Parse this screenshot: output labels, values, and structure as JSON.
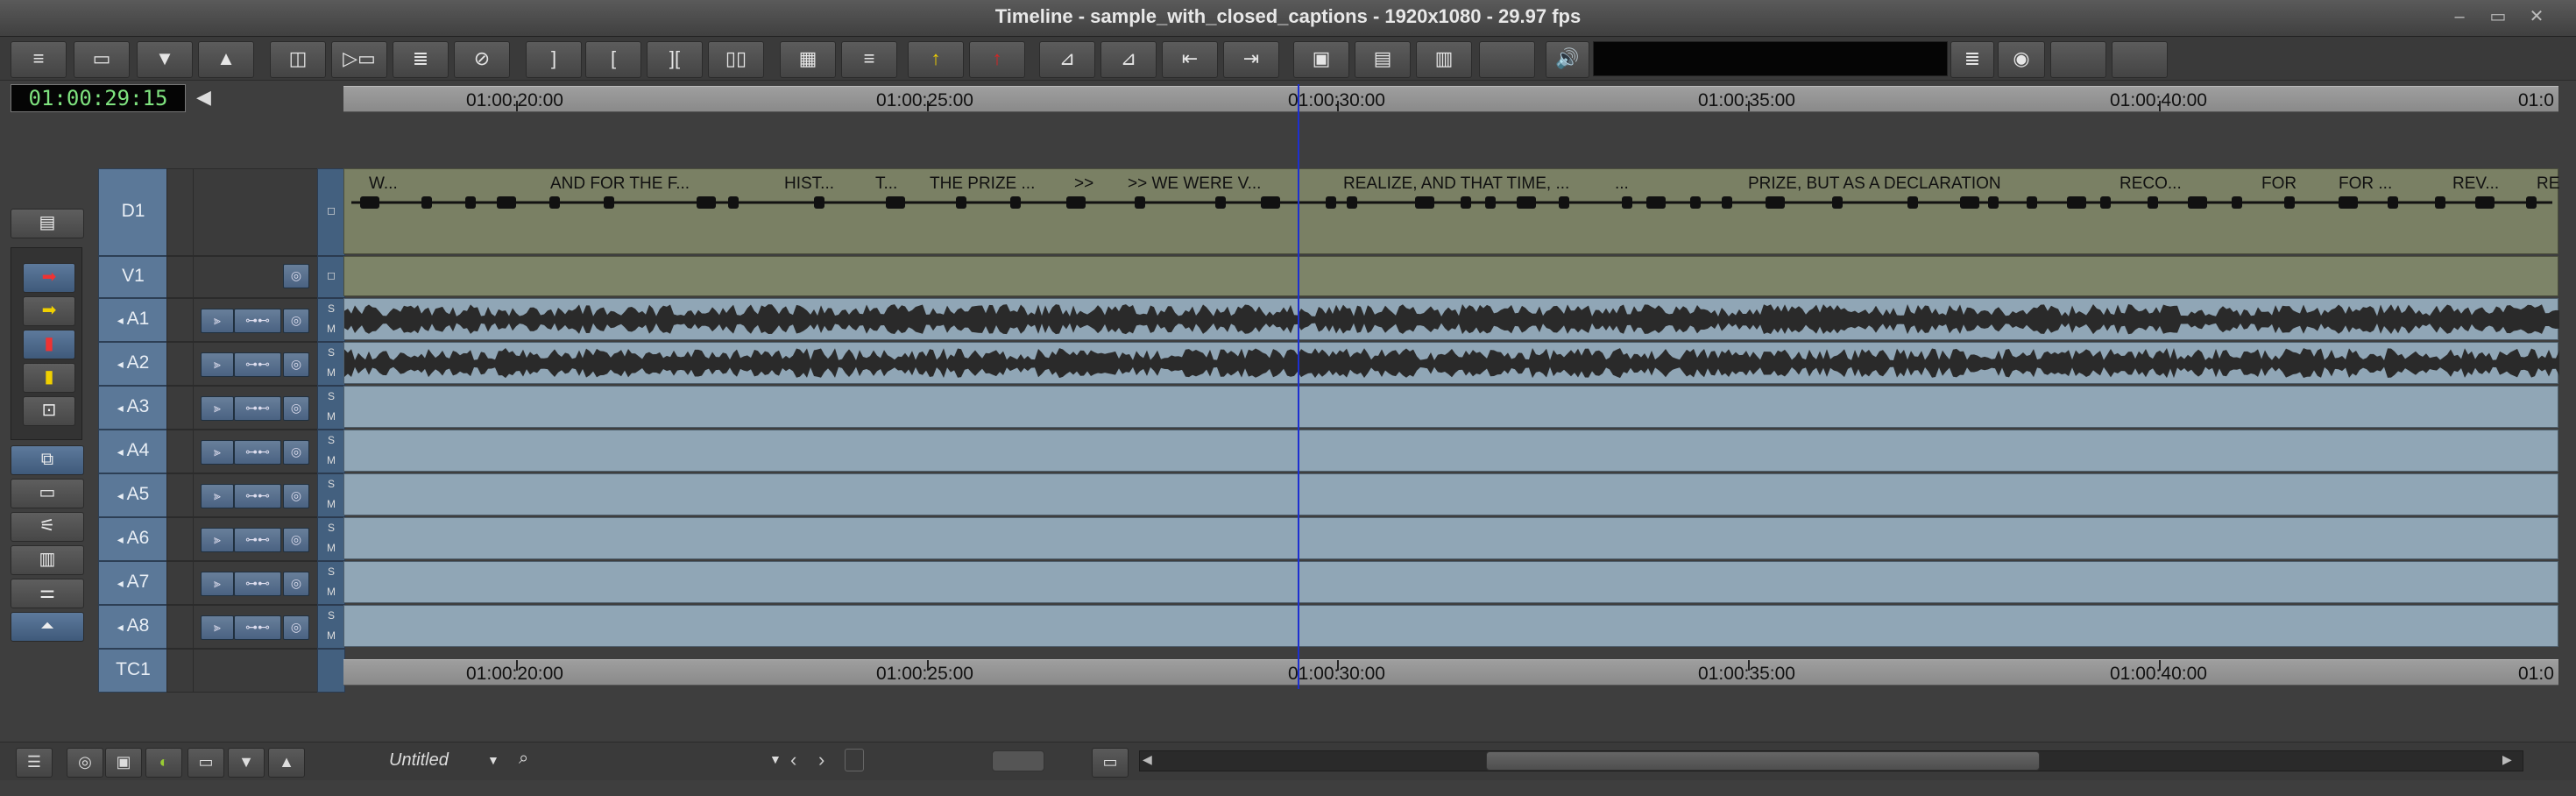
{
  "window": {
    "title": "Timeline - sample_with_closed_captions - 1920x1080 - 29.97 fps",
    "controls": [
      "–",
      "▭",
      "✕"
    ]
  },
  "toolbar": {
    "buttons": [
      "≡",
      "▭",
      "▼",
      "▲",
      "◫",
      "▷▭",
      "≣",
      "⊘",
      "]",
      "[",
      "][",
      "▯▯",
      "▦",
      "≡",
      "↑",
      "↑",
      "⊿",
      "⊿",
      "⇤",
      "⇥",
      "▣",
      "▤",
      "▥",
      "",
      "🔊",
      "",
      "≣",
      "◉",
      "",
      ""
    ]
  },
  "timecode": {
    "current": "01:00:29:15"
  },
  "ruler": {
    "labels": [
      "01:00:20:00",
      "01:00:25:00",
      "01:00:30:00",
      "01:00:35:00",
      "01:00:40:00",
      "01:0"
    ]
  },
  "tracks": {
    "names": [
      "D1",
      "V1",
      "A1",
      "A2",
      "A3",
      "A4",
      "A5",
      "A6",
      "A7",
      "A8",
      "TC1"
    ],
    "solo_label": "S",
    "mute_label": "M"
  },
  "captions": [
    "W...",
    "AND FOR THE F...",
    "HIST...",
    "T...",
    "THE PRIZE ...",
    ">>",
    ">> WE WERE V...",
    "REALIZE, AND THAT TIME, ...",
    "...",
    "PRIZE, BUT AS A DECLARATION",
    "RECO...",
    "FOR",
    "FOR ...",
    "REV...",
    "RE"
  ],
  "bottombar": {
    "sequence_name": "Untitled",
    "dropdown_icon": "chevron-down-icon"
  },
  "colors": {
    "playhead": "#1d2fd0",
    "data_track": "#7a8064",
    "audio_track": "#90a6b6",
    "timecode_text": "#7fe37f",
    "track_header": "#5b7898"
  }
}
